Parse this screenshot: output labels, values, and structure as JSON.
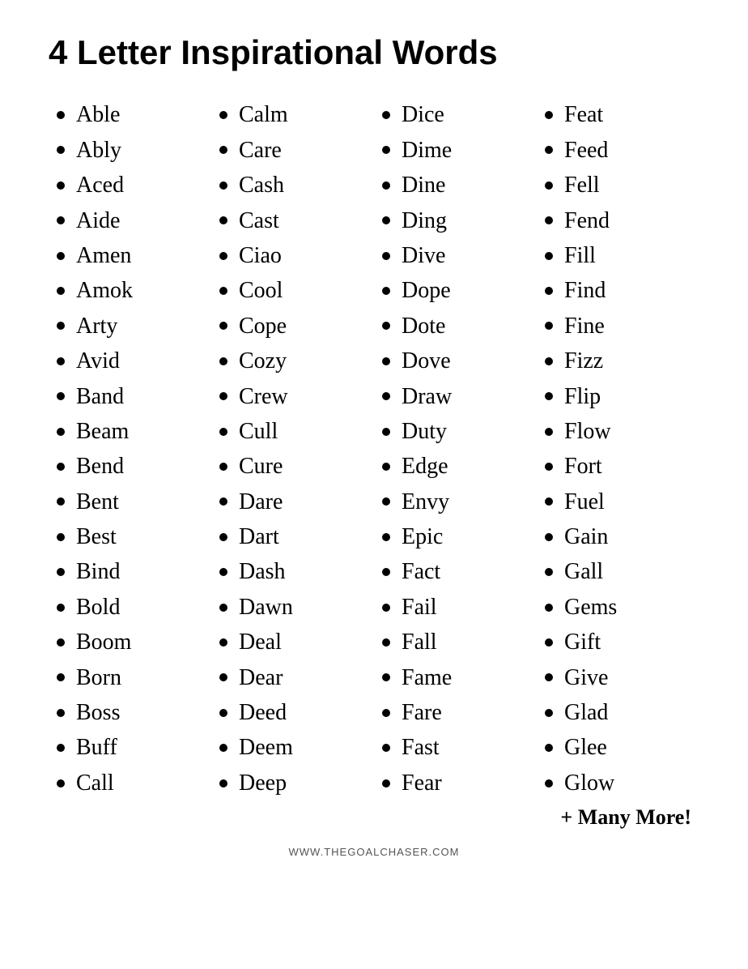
{
  "title": "4 Letter Inspirational Words",
  "columns": [
    {
      "words": [
        "Able",
        "Ably",
        "Aced",
        "Aide",
        "Amen",
        "Amok",
        "Arty",
        "Avid",
        "Band",
        "Beam",
        "Bend",
        "Bent",
        "Best",
        "Bind",
        "Bold",
        "Boom",
        "Born",
        "Boss",
        "Buff",
        "Call"
      ]
    },
    {
      "words": [
        "Calm",
        "Care",
        "Cash",
        "Cast",
        "Ciao",
        "Cool",
        "Cope",
        "Cozy",
        "Crew",
        "Cull",
        "Cure",
        "Dare",
        "Dart",
        "Dash",
        "Dawn",
        "Deal",
        "Dear",
        "Deed",
        "Deem",
        "Deep"
      ]
    },
    {
      "words": [
        "Dice",
        "Dime",
        "Dine",
        "Ding",
        "Dive",
        "Dope",
        "Dote",
        "Dove",
        "Draw",
        "Duty",
        "Edge",
        "Envy",
        "Epic",
        "Fact",
        "Fail",
        "Fall",
        "Fame",
        "Fare",
        "Fast",
        "Fear"
      ]
    },
    {
      "words": [
        "Feat",
        "Feed",
        "Fell",
        "Fend",
        "Fill",
        "Find",
        "Fine",
        "Fizz",
        "Flip",
        "Flow",
        "Fort",
        "Fuel",
        "Gain",
        "Gall",
        "Gems",
        "Gift",
        "Give",
        "Glad",
        "Glee",
        "Glow"
      ]
    }
  ],
  "many_more": "+ Many More!",
  "footer": "WWW.THEGOALCHASER.COM"
}
